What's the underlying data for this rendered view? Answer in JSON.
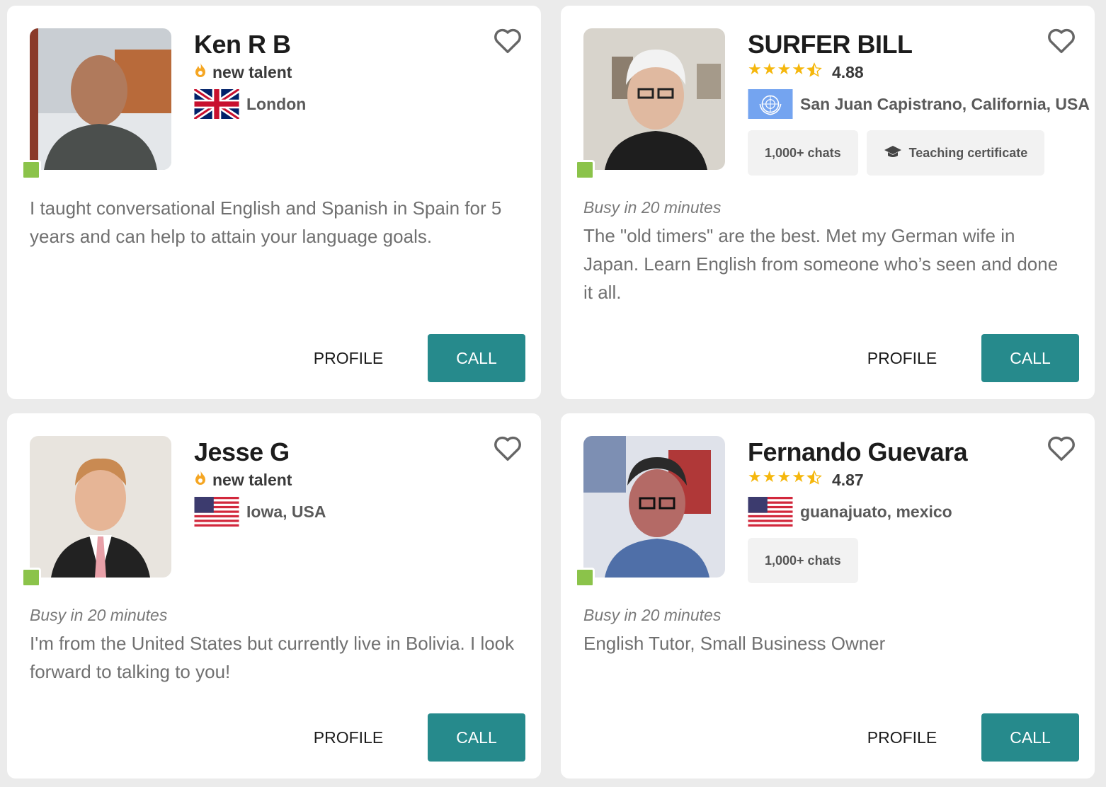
{
  "colors": {
    "accent": "#268a8c",
    "online": "#8bc34a",
    "star": "#f5b70d",
    "new_talent_flame": "#f5a623",
    "background": "#ebebeb"
  },
  "tutors": [
    {
      "name": "Ken R B",
      "tag": "new talent",
      "tag_icon": "flame-icon",
      "location": "London",
      "flag": "uk-flag-icon",
      "badges": [],
      "status": "",
      "bio": "I taught conversational English and Spanish in Spain for 5 years and can help to attain your language goals.",
      "profile_label": "PROFILE",
      "call_label": "CALL",
      "online": true,
      "favorited": false
    },
    {
      "name": "SURFER BILL",
      "rating": "4.88",
      "rating_stars": 4.5,
      "location": "San Juan Capistrano, California, USA",
      "flag": "un-flag-icon",
      "badges": [
        {
          "label": "1,000+ chats",
          "icon": ""
        },
        {
          "label": "Teaching certificate",
          "icon": "graduation-cap-icon"
        }
      ],
      "status": "Busy in 20 minutes",
      "bio": "The \"old timers\" are the best. Met my German wife in Japan. Learn English from someone who’s seen and done it all.",
      "profile_label": "PROFILE",
      "call_label": "CALL",
      "online": true,
      "favorited": false
    },
    {
      "name": "Jesse G",
      "tag": "new talent",
      "tag_icon": "flame-icon",
      "location": "Iowa, USA",
      "flag": "us-flag-icon",
      "badges": [],
      "status": "Busy in 20 minutes",
      "bio": "I'm from the United States but currently live in Bolivia. I look forward to talking to you!",
      "profile_label": "PROFILE",
      "call_label": "CALL",
      "online": true,
      "favorited": false
    },
    {
      "name": "Fernando Guevara",
      "rating": "4.87",
      "rating_stars": 4.5,
      "location": "guanajuato, mexico",
      "flag": "us-flag-icon",
      "badges": [
        {
          "label": "1,000+ chats",
          "icon": ""
        }
      ],
      "status": "Busy in 20 minutes",
      "bio": "English Tutor, Small Business Owner",
      "profile_label": "PROFILE",
      "call_label": "CALL",
      "online": true,
      "favorited": false
    }
  ]
}
